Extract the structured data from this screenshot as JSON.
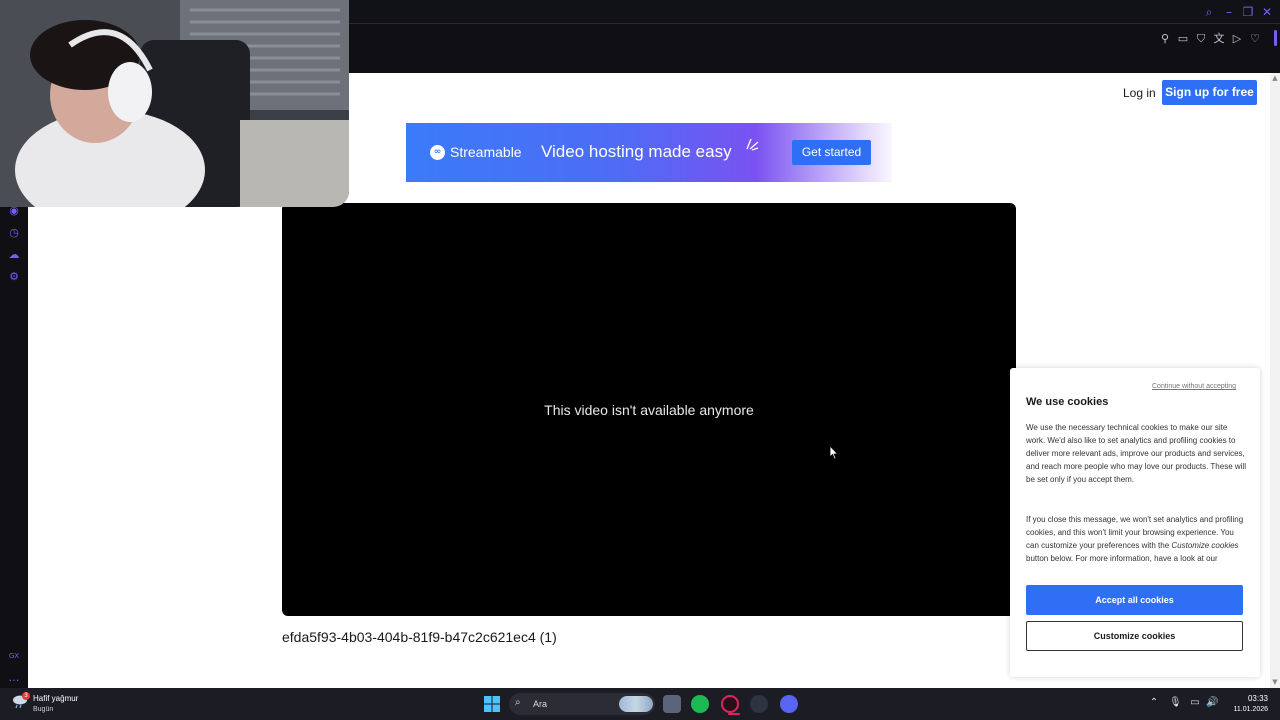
{
  "header": {
    "login_label": "Log in",
    "signup_label": "Sign up for free"
  },
  "banner": {
    "logo_text": "Streamable",
    "headline": "Video hosting made easy",
    "cta_label": "Get started",
    "colors": {
      "start": "#3a7bf8",
      "end": "#faf6ff"
    }
  },
  "video": {
    "unavailable_message": "This video isn't available anymore",
    "title": "efda5f93-4b03-404b-81f9-b47c2c621ec4 (1)"
  },
  "cookie_banner": {
    "continue_link": "Continue without accepting",
    "title": "We use cookies",
    "paragraph1": "We use the necessary technical cookies to make our site work. We'd also like to set analytics and profiling cookies to deliver more relevant ads, improve our products and services, and reach more people who may love our products. These will be set only if you accept them.",
    "paragraph2_before": "If you close this message, we won't set analytics and profiling cookies, and this won't limit your browsing experience. You can customize your preferences with the ",
    "paragraph2_em": "Customize cookies",
    "paragraph2_after": " button below. For more information, have a look at our",
    "accept_label": "Accept all cookies",
    "customize_label": "Customize cookies"
  },
  "taskbar": {
    "weather_text": "Hafif yağmur",
    "weather_sub": "Bugün",
    "weather_badge": "3",
    "search_placeholder": "Ara",
    "time": "03:33",
    "date": "11.01.2026",
    "apps": [
      "file-explorer",
      "spotify",
      "opera-gx",
      "steam",
      "discord"
    ]
  },
  "sidebar": {
    "icons": [
      "player-icon",
      "history-icon",
      "bookmark-icon",
      "settings-icon",
      "gx-icon",
      "more-icon"
    ]
  },
  "colors": {
    "accent": "#2f6ff6",
    "browser_accent": "#7b5cff"
  }
}
